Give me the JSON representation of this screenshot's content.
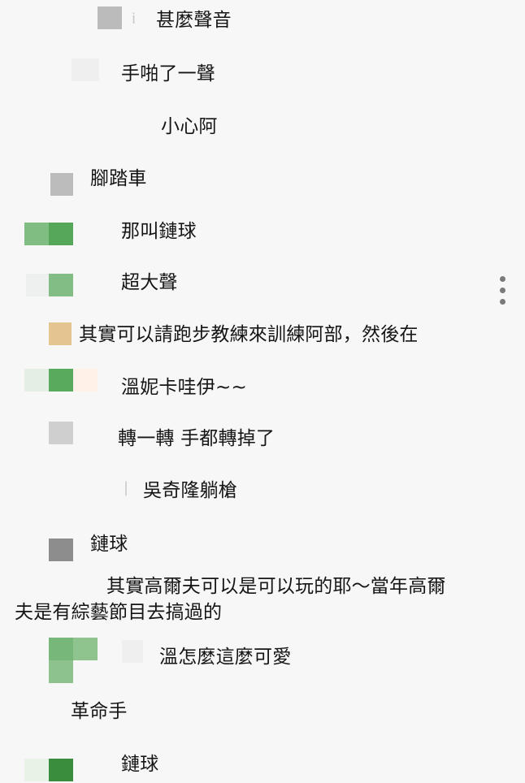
{
  "chat": {
    "messages": [
      {
        "text": "甚麼聲音"
      },
      {
        "text": "手啪了一聲"
      },
      {
        "text": "小心阿"
      },
      {
        "text": "腳踏車"
      },
      {
        "text": "那叫鏈球"
      },
      {
        "text": "超大聲"
      },
      {
        "text": "其實可以請跑步教練來訓練阿部，然後在"
      },
      {
        "text": "溫妮卡哇伊~~"
      },
      {
        "text": "轉一轉 手都轉掉了"
      },
      {
        "text": "吳奇隆躺槍"
      },
      {
        "text": "鏈球"
      },
      {
        "text": "其實高爾夫可以是可以玩的耶～當年高爾"
      },
      {
        "text": "夫是有綜藝節目去搞過的"
      },
      {
        "text": "溫怎麼這麼可愛"
      },
      {
        "text": "革命手"
      },
      {
        "text": "鏈球"
      }
    ]
  },
  "menu": {
    "icon": "more-vertical-icon"
  },
  "colors": {
    "background": "#f7f7f7",
    "text": "#151515",
    "green": "#5fa866",
    "dark_green": "#3b8d3e",
    "tan": "#e5c58f",
    "gray": "#b9b9b9"
  }
}
